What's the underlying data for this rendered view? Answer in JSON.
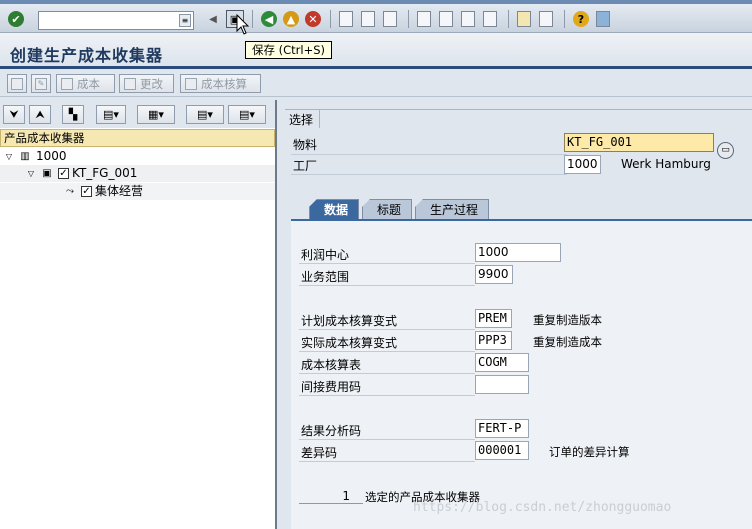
{
  "window": {
    "title": "创建生产成本收集器"
  },
  "tooltip": {
    "text": "保存   (Ctrl+S)"
  },
  "command_field": {
    "value": ""
  },
  "app_toolbar": {
    "buttons": [
      {
        "label": "成本"
      },
      {
        "label": "更改"
      },
      {
        "label": "成本核算"
      }
    ]
  },
  "tree": {
    "header": "产品成本收集器",
    "nodes": [
      {
        "label": "1000"
      },
      {
        "label": "KT_FG_001"
      },
      {
        "label": "集体经营"
      }
    ]
  },
  "selection": {
    "title": "选择",
    "material_label": "物料",
    "material_value": "KT_FG_001",
    "plant_label": "工厂",
    "plant_value": "1000",
    "plant_desc": "Werk Hamburg"
  },
  "tabs": [
    {
      "label": "数据",
      "active": true
    },
    {
      "label": "标题",
      "active": false
    },
    {
      "label": "生产过程",
      "active": false
    }
  ],
  "data_tab": {
    "profit_center_label": "利润中心",
    "profit_center_value": "1000",
    "business_area_label": "业务范围",
    "business_area_value": "9900",
    "plan_variant_label": "计划成本核算变式",
    "plan_variant_value": "PREM",
    "plan_variant_desc": "重复制造版本",
    "actual_variant_label": "实际成本核算变式",
    "actual_variant_value": "PPP3",
    "actual_variant_desc": "重复制造成本",
    "costing_sheet_label": "成本核算表",
    "costing_sheet_value": "COGM",
    "overhead_key_label": "间接费用码",
    "overhead_key_value": "",
    "results_analysis_label": "结果分析码",
    "results_analysis_value": "FERT-P",
    "variance_key_label": "差异码",
    "variance_key_value": "000001",
    "variance_key_desc": "订单的差异计算",
    "selected_count": "1",
    "selected_label": "选定的产品成本收集器"
  },
  "watermark": "https://blog.csdn.net/zhongguomao",
  "colors": {
    "title_text": "#203a5f",
    "tab_active": "#3c68a0",
    "tree_header": "#f5e8b3",
    "focus_field": "#fde9a8"
  }
}
